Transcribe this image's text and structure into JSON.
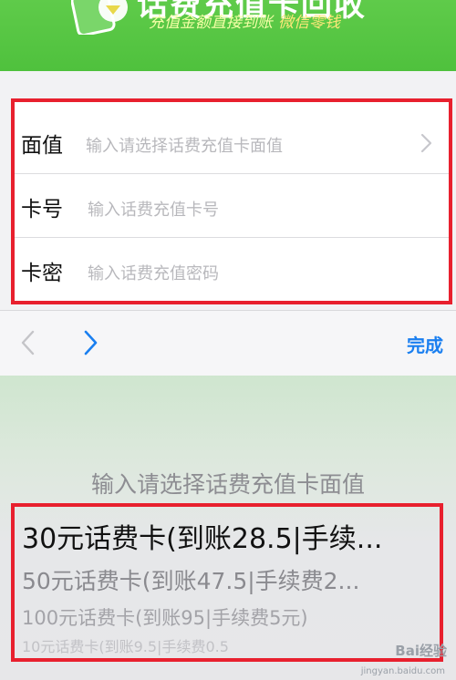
{
  "banner": {
    "title": "话费充值卡回收",
    "subtitle_a": "充值金额直接到账",
    "subtitle_b": "微信零钱",
    "colors": {
      "green": "#56c544",
      "subtitle_yellow": "#f4ffa6"
    }
  },
  "form": {
    "rows": [
      {
        "label": "面值",
        "placeholder": "输入请选择话费充值卡面值",
        "icon": "chevron-right-icon"
      },
      {
        "label": "卡号",
        "placeholder": "输入话费充值卡号"
      },
      {
        "label": "卡密",
        "placeholder": "输入话费充值密码"
      }
    ],
    "highlight_color": "#e8202e"
  },
  "toolbar": {
    "prev_icon": "chevron-left-icon",
    "next_icon": "chevron-right-icon",
    "done_label": "完成",
    "accent": "#1a7ff0"
  },
  "picker": {
    "title": "输入请选择话费充值卡面值",
    "options": [
      "30元话费卡(到账28.5|手续...",
      "50元话费卡(到账47.5|手续费2...",
      "100元话费卡(到账95|手续费5元)",
      "10元话费卡(到账9.5|手续费0.5"
    ],
    "selected_index": 0
  },
  "watermark": {
    "text": "Bai经验",
    "sub": "jingyan.baidu.com"
  }
}
